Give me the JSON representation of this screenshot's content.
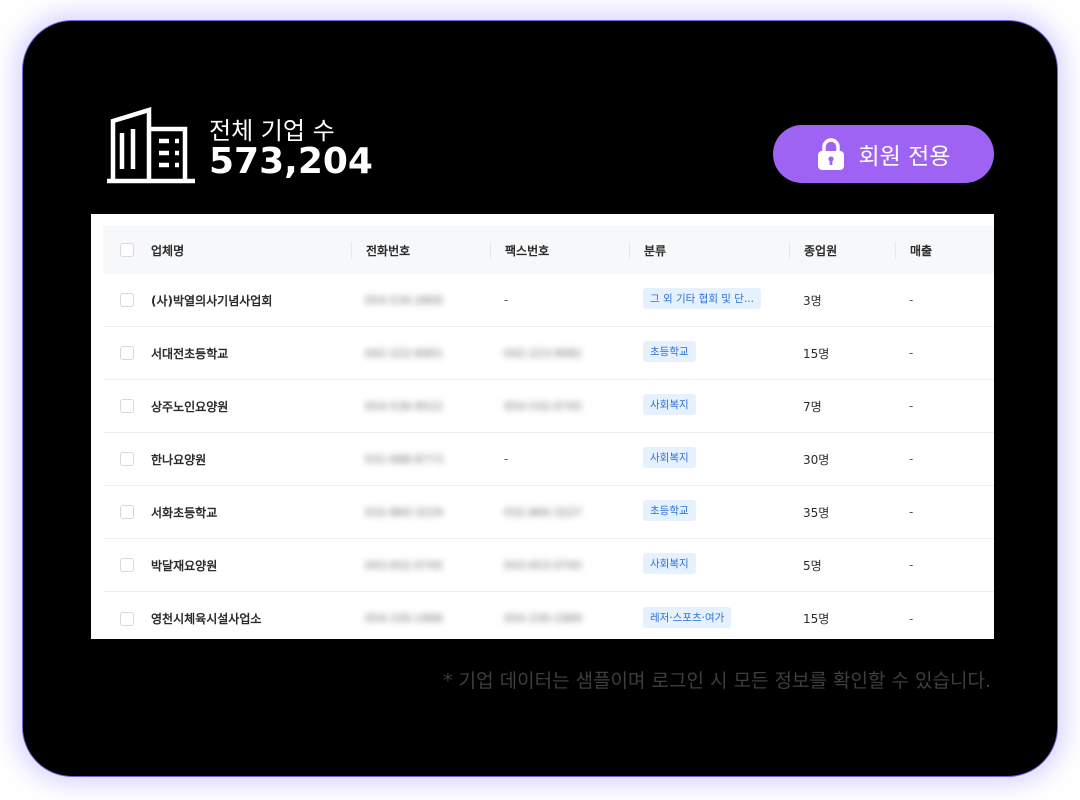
{
  "summary": {
    "label": "전체 기업 수",
    "count": "573,204"
  },
  "member_button": {
    "label": "회원 전용",
    "icon": "lock-icon",
    "color": "#9f63f4"
  },
  "table": {
    "columns": [
      "업체명",
      "전화번호",
      "팩스번호",
      "분류",
      "종업원",
      "매출"
    ],
    "rows": [
      {
        "name": "(사)박열의사기념사업회",
        "phone": "054-534-2800",
        "fax": "-",
        "category": "그 외 기타 협회 및 단...",
        "employees": "3명",
        "sales": "-"
      },
      {
        "name": "서대전초등학교",
        "phone": "042-222-6901",
        "fax": "042-223-9082",
        "category": "초등학교",
        "employees": "15명",
        "sales": "-"
      },
      {
        "name": "상주노인요양원",
        "phone": "054-536-9522",
        "fax": "054-532-0745",
        "category": "사회복지",
        "employees": "7명",
        "sales": "-"
      },
      {
        "name": "한나요양원",
        "phone": "031-688-8773",
        "fax": "-",
        "category": "사회복지",
        "employees": "30명",
        "sales": "-"
      },
      {
        "name": "서화초등학교",
        "phone": "032-860-3229",
        "fax": "032-860-3227",
        "category": "초등학교",
        "employees": "35명",
        "sales": "-"
      },
      {
        "name": "박달재요양원",
        "phone": "043-652-0745",
        "fax": "043-653-0745",
        "category": "사회복지",
        "employees": "5명",
        "sales": "-"
      },
      {
        "name": "영천시체육시설사업소",
        "phone": "054-330-1966",
        "fax": "054-330-1969",
        "category": "레저·스포츠·여가",
        "employees": "15명",
        "sales": "-"
      }
    ]
  },
  "footnote": "* 기업 데이터는 샘플이며 로그인 시 모든 정보를 확인할 수 있습니다.",
  "colors": {
    "background": "#000000",
    "accent": "#9f63f4",
    "tag_bg": "#e6f1ff",
    "tag_text": "#2c6fd8"
  }
}
